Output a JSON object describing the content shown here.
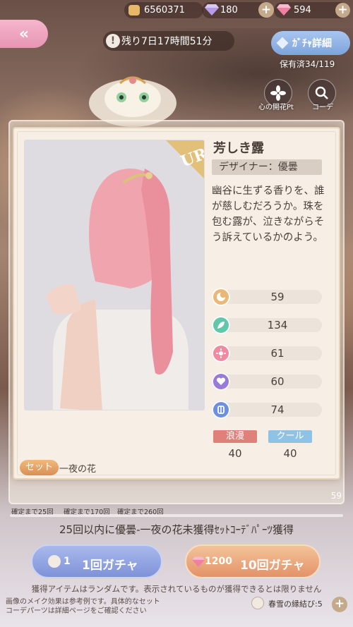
{
  "currency": {
    "gold": "6560371",
    "diamond": "180",
    "pink_diamond": "594"
  },
  "event": {
    "timer": "残り7日17時間51分",
    "gacha_detail_label": "ｶﾞﾁｬ詳細",
    "owned": "保有済34/119",
    "heart_flower_label": "心の開花Pt",
    "coordinate_label": "コーデ"
  },
  "item": {
    "rarity": "UR",
    "title": "芳しき露",
    "designer": "デザイナー：優曇",
    "description": "幽谷に生ずる香りを、誰が慈しむだろうか。珠を包む露が、泣きながらそう訴えているかのよう。",
    "stats": [
      {
        "icon": "elegance-icon",
        "value": "59",
        "color": "#e9b877"
      },
      {
        "icon": "freshness-icon",
        "value": "134",
        "color": "#62c7a9"
      },
      {
        "icon": "sweetness-icon",
        "value": "61",
        "color": "#f08aa0"
      },
      {
        "icon": "sexy-icon",
        "value": "60",
        "color": "#9a7ad8"
      },
      {
        "icon": "cool-icon",
        "value": "74",
        "color": "#6c8fe0"
      }
    ],
    "style_tags": [
      {
        "label": "浪漫",
        "value": "40",
        "color": "#e0807a"
      },
      {
        "label": "クール",
        "value": "40",
        "color": "#8fc3e6"
      }
    ],
    "set_label": "セット",
    "set_name": "一夜の花"
  },
  "guarantee": {
    "items": [
      "確定まで25回",
      "確定まで170回",
      "確定まで260回"
    ],
    "side_number": "59",
    "promo": "25回以内に優曇-一夜の花未獲得ｾｯﾄｺｰﾃﾞﾊﾟｰﾂ獲得"
  },
  "buttons": {
    "single_cost": "1",
    "single_label": "1回ガチャ",
    "ten_cost": "1200",
    "ten_label": "10回ガチャ"
  },
  "notes": {
    "random_note": "獲得アイテムはランダムです。表示されているものが獲得できるとは限りません",
    "image_note_line1": "画像のメイク効果は参考例です。具体的なセット",
    "image_note_line2": "コーデパーツは詳細ページをご確認ください",
    "ticket": "春雪の縁結び:5"
  }
}
